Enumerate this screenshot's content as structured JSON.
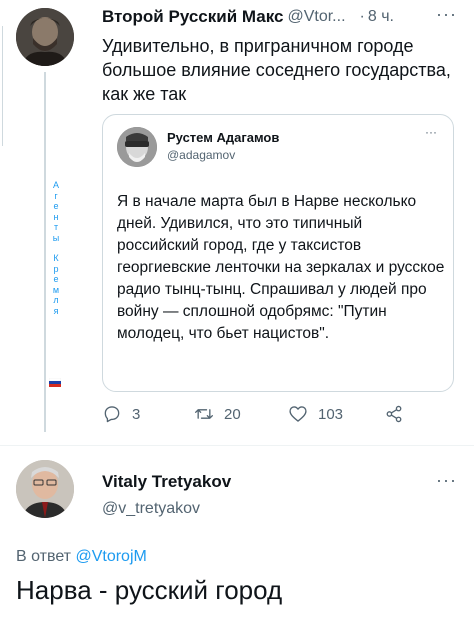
{
  "tweet": {
    "author_name": "Второй Русский Макс",
    "author_handle": "@Vtor...",
    "separator": "·",
    "time": "8 ч.",
    "more": "···",
    "text": "Удивительно, в приграничном городе большое влияние соседнего государства, как же так",
    "bio_vertical": [
      "А",
      "г",
      "е",
      "н",
      "т",
      "ы",
      " ",
      "К",
      "р",
      "е",
      "м",
      "л",
      "я"
    ],
    "quote": {
      "author_name": "Рустем Адагамов",
      "author_handle": "@adagamov",
      "more": "···",
      "text": "Я в начале марта был в Нарве несколько дней. Удивился, что это типичный российский город, где у таксистов георгиевские ленточки на зеркалах и русское радио тынц-тынц. Спрашивал у людей про войну — сплошной одобрямс: \"Путин молодец, что бьет нацистов\"."
    },
    "actions": {
      "reply_count": "3",
      "retweet_count": "20",
      "like_count": "103"
    }
  },
  "reply_tweet": {
    "author_name": "Vitaly Tretyakov",
    "author_handle": "@v_tretyakov",
    "more": "···",
    "reply_to_prefix": "В ответ",
    "reply_to_handle": "@VtorojM",
    "text": "Нарва - русский город"
  },
  "colors": {
    "accent": "#1d9bf0",
    "secondary_text": "#536471",
    "border": "#cfd9de"
  },
  "icons": [
    "reply-icon",
    "retweet-icon",
    "like-icon",
    "share-icon",
    "flag-icon"
  ]
}
